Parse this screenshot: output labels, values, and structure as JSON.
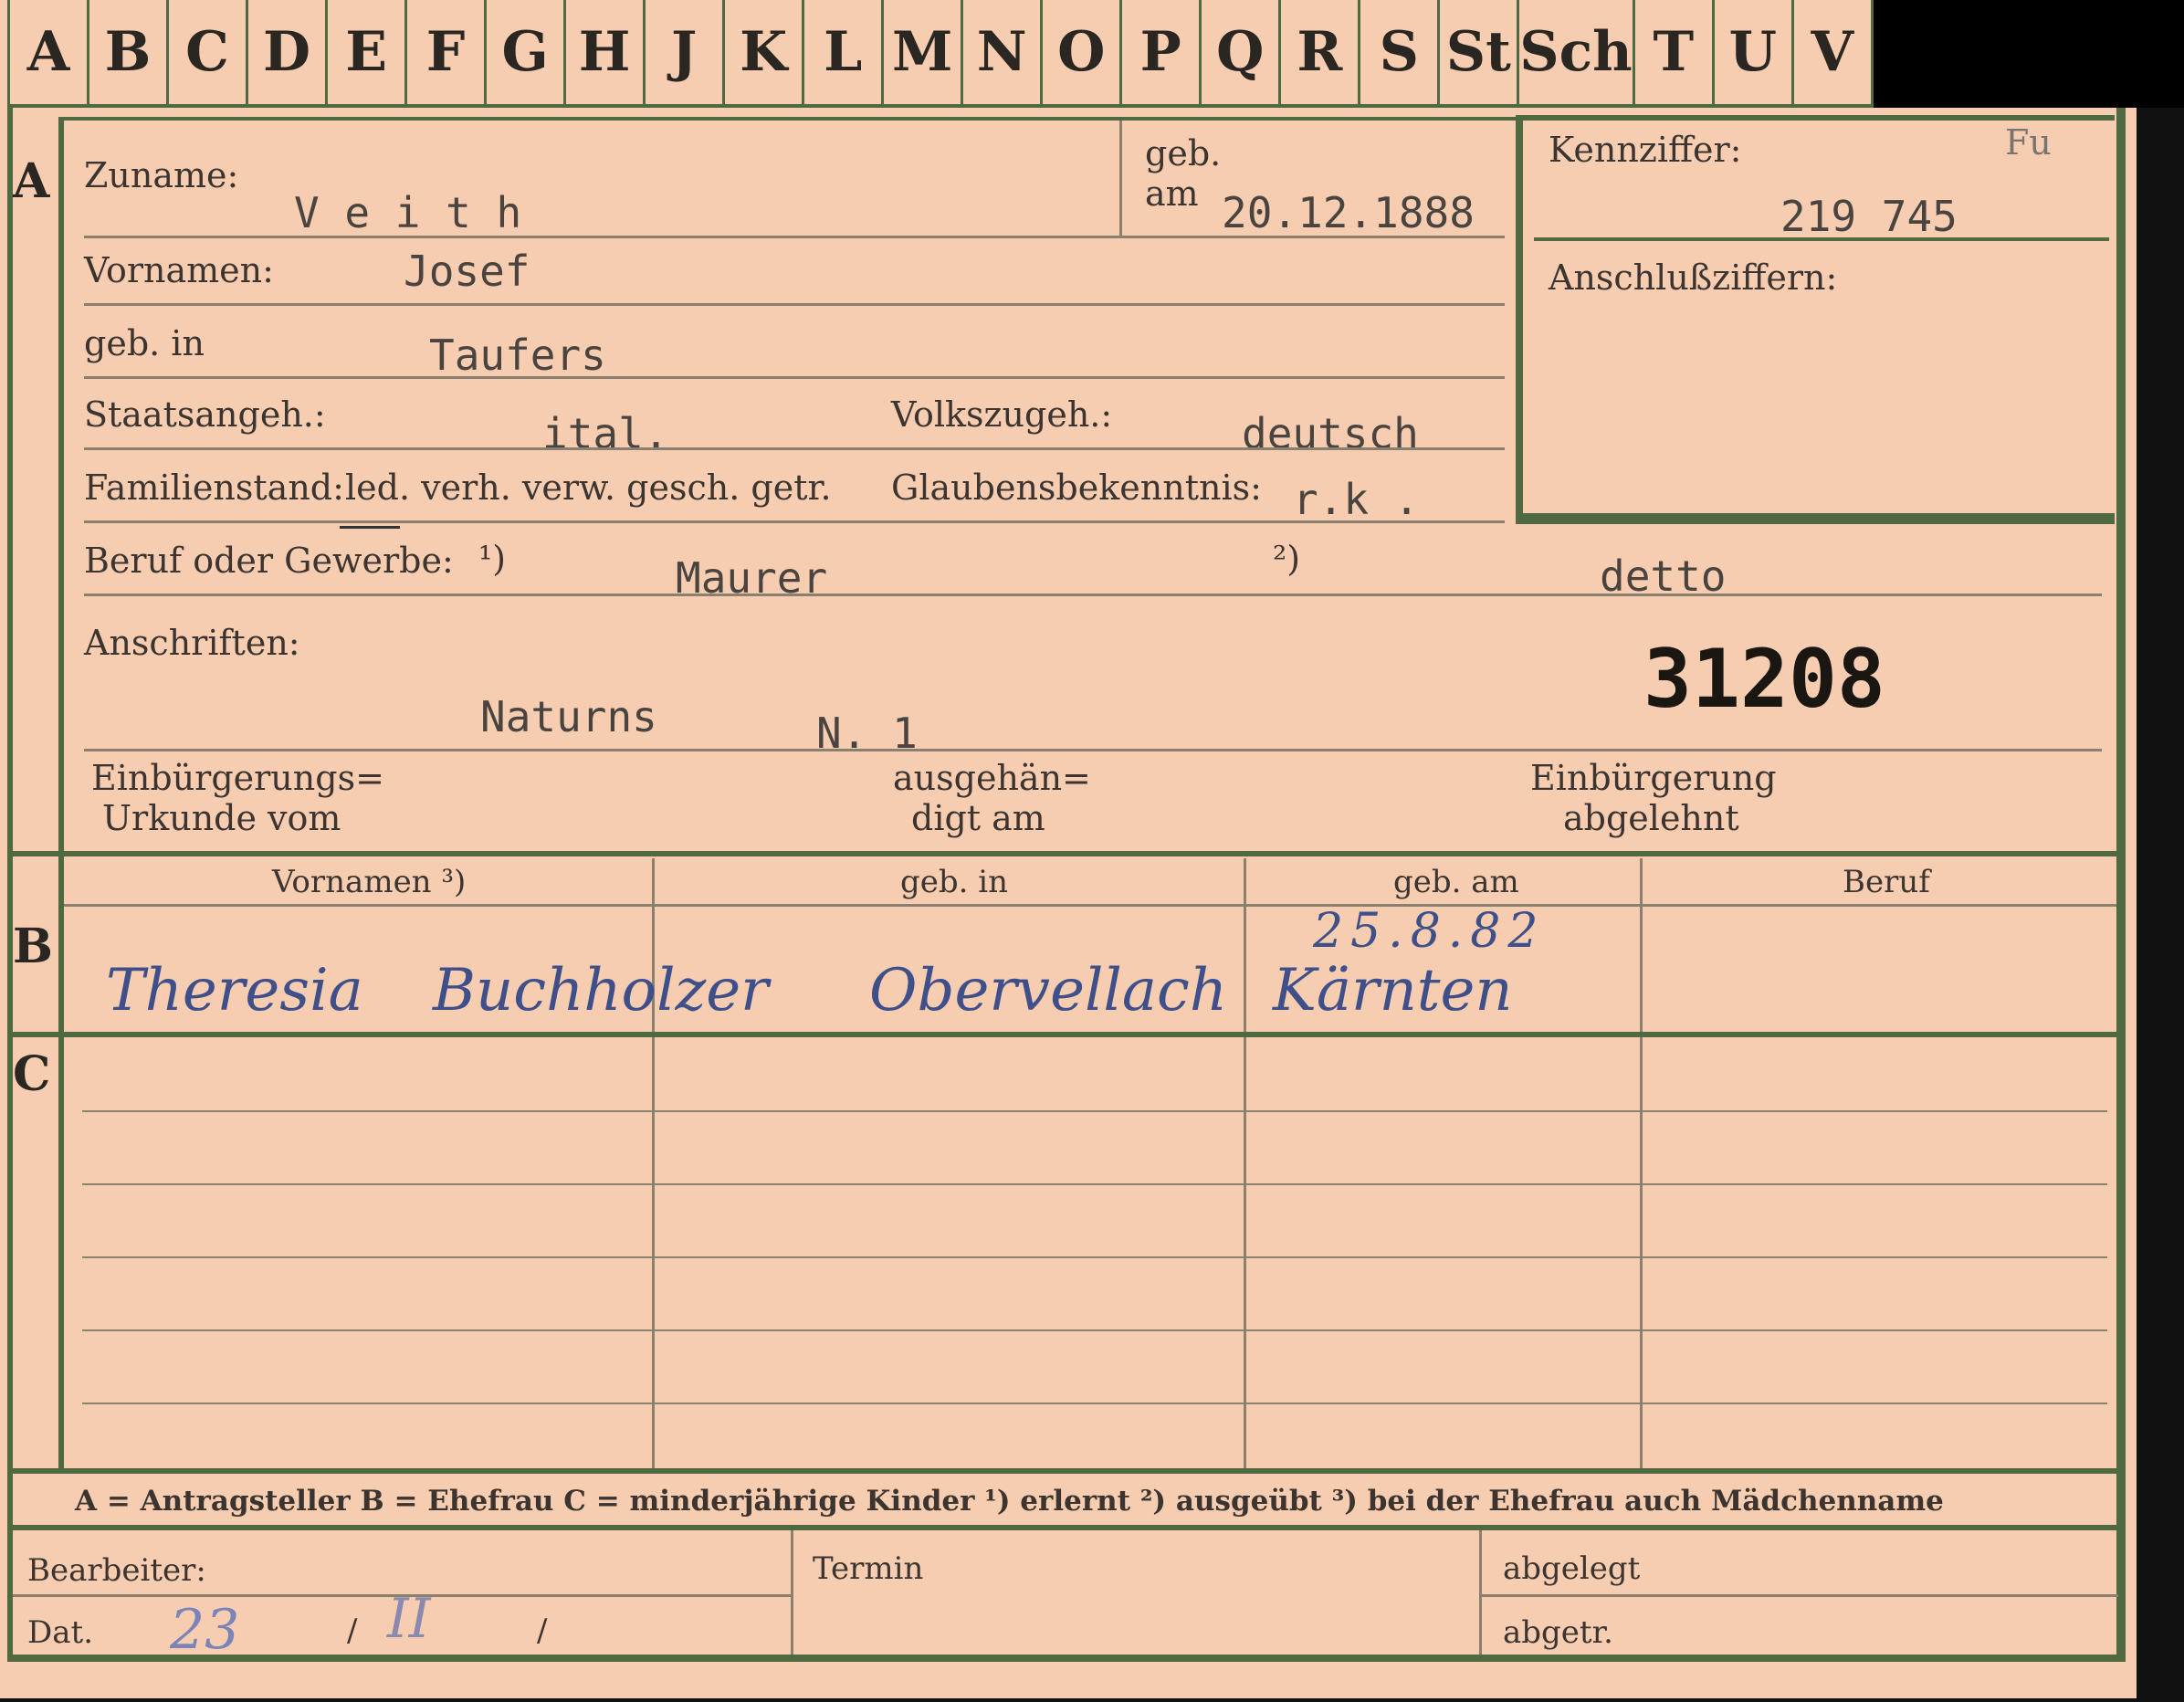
{
  "tabs": [
    "A",
    "B",
    "C",
    "D",
    "E",
    "F",
    "G",
    "H",
    "J",
    "K",
    "L",
    "M",
    "N",
    "O",
    "P",
    "Q",
    "R",
    "S",
    "St",
    "Sch",
    "T",
    "U",
    "V"
  ],
  "sections": {
    "a": "A",
    "b": "B",
    "c": "C"
  },
  "person": {
    "zuname_label": "Zuname:",
    "zuname": "V e i t h",
    "geb_label": "geb.",
    "am_label": "am",
    "geb_am": "20.12.1888",
    "vornamen_label": "Vornamen:",
    "vornamen": "Josef",
    "gebin_label": "geb. in",
    "gebin": "Taufers",
    "staats_label": "Staatsangeh.:",
    "staats": "ital.",
    "volks_label": "Volkszugeh.:",
    "volks": "deutsch",
    "famstand_label": "Familienstand:",
    "famstand_options": "led. verh. verw. gesch. getr.",
    "glauben_label": "Glaubensbekenntnis:",
    "glauben": "r.k .",
    "beruf_label": "Beruf oder Gewerbe:",
    "beruf_fn1": "¹)",
    "beruf1": "Maurer",
    "beruf_fn2": "²)",
    "beruf2": "detto",
    "anschr_label": "Anschriften:",
    "anschr_place": "Naturns",
    "anschr_num": "N. 1",
    "number_stamp": "31208",
    "einb_urk_1": "Einbürgerungs=",
    "einb_urk_2": "Urkunde vom",
    "ausgeh_1": "ausgehän=",
    "ausgeh_2": "digt am",
    "einb_abg_1": "Einbürgerung",
    "einb_abg_2": "abgelehnt"
  },
  "kenn": {
    "label": "Kennziffer:",
    "note": "Fu",
    "value": "219 745",
    "anschluss_label": "Anschlußziffern:"
  },
  "spouse_table": {
    "headers": [
      "Vornamen ³)",
      "geb. in",
      "geb. am",
      "Beruf"
    ],
    "date": "25.8.82",
    "handwritten": [
      "Theresia",
      "Buchholzer",
      "Obervellach",
      "Kärnten"
    ]
  },
  "legend": "A = Antragsteller   B = Ehefrau   C = minderjährige Kinder   ¹) erlernt   ²) ausgeübt   ³) bei der Ehefrau auch Mädchenname",
  "footer": {
    "bearbeiter": "Bearbeiter:",
    "dat": "Dat.",
    "dat_day": "23",
    "slash1": "/",
    "dat_month": "II",
    "slash2": "/",
    "termin": "Termin",
    "abgelegt": "abgelegt",
    "abgetr": "abgetr."
  }
}
